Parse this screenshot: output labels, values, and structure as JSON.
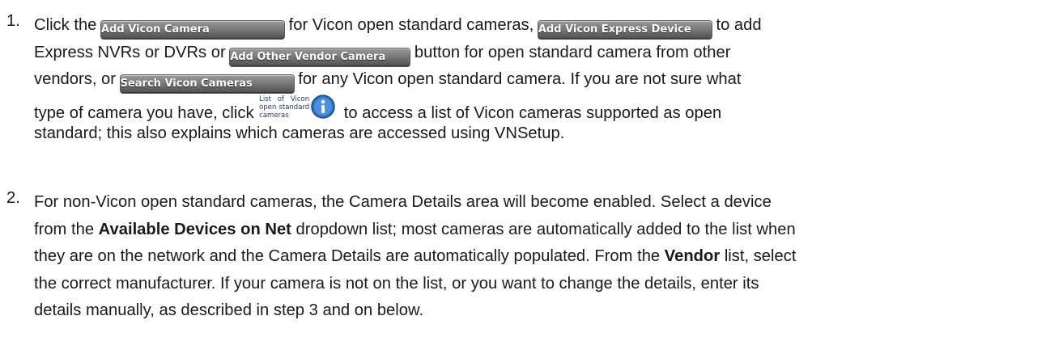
{
  "steps": [
    {
      "number": "1.",
      "buttons": {
        "add_vicon_camera": "Add Vicon Camera",
        "add_vicon_express_device": "Add Vicon Express Device",
        "add_other_vendor_camera": "Add Other Vendor Camera",
        "search_vicon_cameras": "Search Vicon Cameras",
        "list_help_caption": "List of Vicon open standard cameras"
      },
      "text": {
        "click_the": "Click the",
        "after_add_vicon": "for Vicon open standard cameras,",
        "to_add": "to add",
        "express_nvrs": "Express NVRs or DVRs or",
        "button_for_open": "button for open standard camera from other",
        "vendors_or": "vendors, or",
        "for_any": "for any Vicon open standard camera. If you are not sure what",
        "type_of_camera": "type of camera you have, click",
        "to_access": "to access a list of Vicon cameras supported as open",
        "standard_line": "standard; this also explains which cameras are accessed using VNSetup."
      }
    },
    {
      "number": "2.",
      "text": {
        "l1": "For non-Vicon open standard cameras, the Camera Details area will become enabled. Select a device",
        "l2_a": "from the",
        "l2_b": "Available Devices on Net",
        "l2_c": "dropdown list; most cameras are automatically added to the list when",
        "l3_a": "they are on the network and the Camera Details are automatically populated. From the",
        "l3_b": "Vendor",
        "l3_c": "list, select",
        "l4": "the correct manufacturer. If your camera is not on the list, or you want to change the details, enter its",
        "l5": "details manually, as described in step 3 and on below."
      }
    }
  ],
  "colors": {
    "button_gradient_top": "#9a9a9a",
    "button_gradient_bottom": "#4f4f4f",
    "info_icon": "#2f6fc0"
  },
  "icons": {
    "info": "info-circle-icon"
  }
}
